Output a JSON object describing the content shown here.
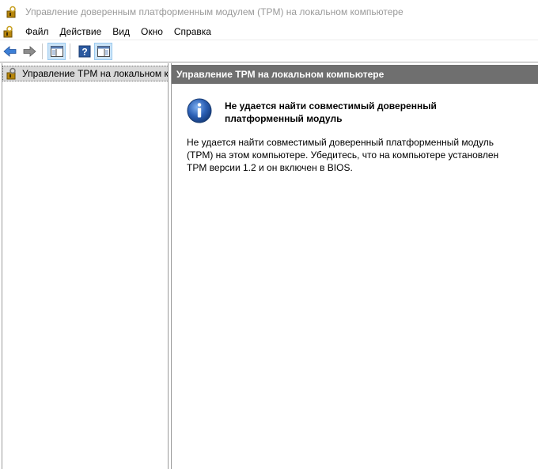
{
  "window": {
    "title": "Управление доверенным платформенным модулем (TPM) на локальном компьютере"
  },
  "menu": {
    "items": [
      "Файл",
      "Действие",
      "Вид",
      "Окно",
      "Справка"
    ]
  },
  "toolbar": {
    "buttons": [
      "back-arrow-icon",
      "forward-arrow-icon",
      "show-hide-tree-icon",
      "help-icon",
      "action-pane-icon"
    ]
  },
  "tree": {
    "root_label": "Управление TPM на локальном к"
  },
  "main": {
    "header": "Управление TPM на локальном компьютере",
    "message_title": "Не удается найти совместимый доверенный платформенный модуль",
    "message_body": "Не удается найти совместимый доверенный платформенный модуль (TPM) на этом компьютере. Убедитесь, что на компьютере установлен TPM версии 1.2 и он включен в BIOS."
  },
  "colors": {
    "pane_header_bg": "#6f6f6f",
    "tree_selected_bg": "#d9d9d9",
    "info_icon_blue": "#2b5fb4"
  }
}
